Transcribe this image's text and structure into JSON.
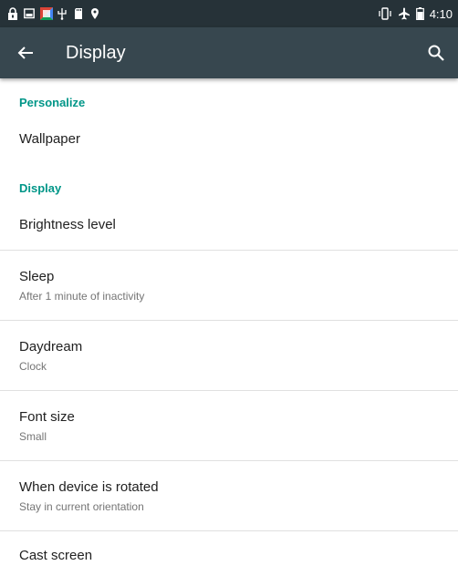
{
  "status_bar": {
    "time": "4:10",
    "left_icons": [
      "lock-icon",
      "screenshot-icon",
      "app-icon",
      "usb-icon",
      "sd-card-icon",
      "location-pin-icon"
    ],
    "right_icons": [
      "vibrate-icon",
      "airplane-icon",
      "battery-icon"
    ]
  },
  "toolbar": {
    "title": "Display",
    "back_icon": "arrow-left-icon",
    "search_icon": "search-icon",
    "background": "#37474f"
  },
  "sections": {
    "personalize": {
      "header": "Personalize",
      "wallpaper": {
        "title": "Wallpaper"
      }
    },
    "display": {
      "header": "Display",
      "brightness": {
        "title": "Brightness level"
      },
      "sleep": {
        "title": "Sleep",
        "summary": "After 1 minute of inactivity"
      },
      "daydream": {
        "title": "Daydream",
        "summary": "Clock"
      },
      "font_size": {
        "title": "Font size",
        "summary": "Small"
      },
      "rotation": {
        "title": "When device is rotated",
        "summary": "Stay in current orientation"
      },
      "cast": {
        "title": "Cast screen"
      }
    }
  },
  "colors": {
    "accent": "#009688",
    "status_bar": "#263238",
    "divider": "#e0e0e0"
  }
}
